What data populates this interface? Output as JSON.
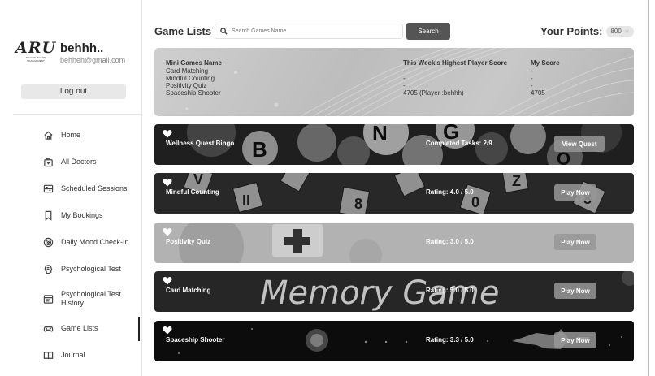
{
  "profile": {
    "logo_text": "ARU",
    "logo_subtext": "SCHOOL BOARD MANAGEMENT",
    "name": "behhh..",
    "email": "behheh@gmail.com",
    "logout_label": "Log out"
  },
  "nav": [
    {
      "label": "Home",
      "icon": "home-icon"
    },
    {
      "label": "All Doctors",
      "icon": "medical-bag-icon"
    },
    {
      "label": "Scheduled Sessions",
      "icon": "sessions-icon"
    },
    {
      "label": "My Bookings",
      "icon": "bookmark-icon"
    },
    {
      "label": "Daily Mood Check-In",
      "icon": "mood-icon"
    },
    {
      "label": "Psychological Test",
      "icon": "brain-icon"
    },
    {
      "label": "Psychological Test History",
      "icon": "history-icon"
    },
    {
      "label": "Game Lists",
      "icon": "gamepad-icon",
      "active": true
    },
    {
      "label": "Journal",
      "icon": "journal-icon"
    }
  ],
  "header": {
    "title": "Game Lists",
    "search_placeholder": "Search Games Name",
    "search_button": "Search",
    "points_label": "Your Points:",
    "points_value": "800"
  },
  "stats": {
    "headers": [
      "Mini Games Name",
      "This Week's Highest Player Score",
      "My Score"
    ],
    "rows": [
      [
        "Card Matching",
        "-",
        "-"
      ],
      [
        "Mindful Counting",
        "-",
        "-"
      ],
      [
        "Positivity Quiz",
        "-",
        "-"
      ],
      [
        "Spaceship Shooter",
        "4705 (Player :behhh)",
        "4705"
      ]
    ]
  },
  "games": [
    {
      "title": "Wellness Quest Bingo",
      "meta": "Completed Tasks: 2/9",
      "button": "View Quest"
    },
    {
      "title": "Mindful Counting",
      "meta": "Rating: 4.0 / 5.0",
      "button": "Play Now"
    },
    {
      "title": "Positivity Quiz",
      "meta": "Rating: 3.0 / 5.0",
      "button": "Play Now"
    },
    {
      "title": "Card Matching",
      "meta": "Rating: 5.0 / 5.0",
      "button": "Play Now",
      "banner_text": "Memory Game"
    },
    {
      "title": "Spaceship Shooter",
      "meta": "Rating: 3.3 / 5.0",
      "button": "Play Now"
    }
  ]
}
